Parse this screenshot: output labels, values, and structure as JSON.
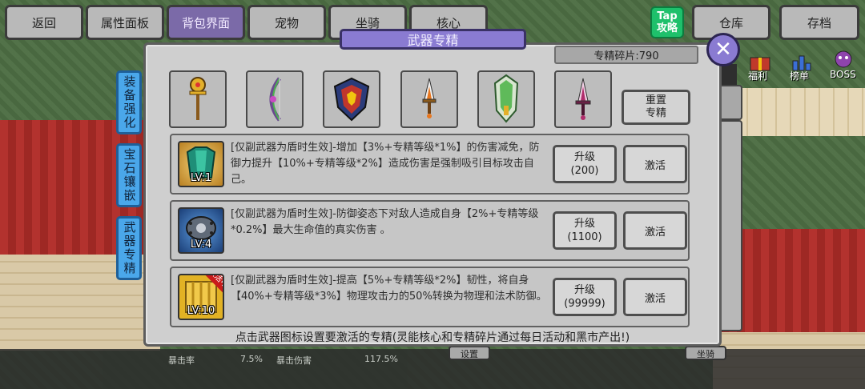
{
  "top_nav": {
    "items": [
      "返回",
      "属性面板",
      "背包界面",
      "宠物",
      "坐骑",
      "核心"
    ],
    "active_index": 2,
    "logo_text": "Tap\n攻略",
    "right_items": [
      "仓库",
      "存档"
    ]
  },
  "background": {
    "side_icon_labels": [
      "福利",
      "榜单",
      "BOSS"
    ],
    "bottom_cells": [
      "暴击率",
      "7.5%",
      "暴击伤害",
      "117.5%"
    ],
    "bottom_buttons": [
      "设置",
      "坐骑"
    ]
  },
  "modal": {
    "title": "武器专精",
    "shards_label": "专精碎片:790",
    "left_tabs": [
      {
        "label": "装备强化"
      },
      {
        "label": "宝石镶嵌"
      },
      {
        "label": "武器专精"
      }
    ],
    "weapons": [
      {
        "icon": "golden-staff-icon",
        "color": "#d9a521"
      },
      {
        "icon": "dragon-bow-icon",
        "color": "#7a5aa0"
      },
      {
        "icon": "crested-shield-icon",
        "color": "#c1362c"
      },
      {
        "icon": "flame-dagger-icon",
        "color": "#e8771f"
      },
      {
        "icon": "emerald-shield-icon",
        "color": "#5fba5a"
      },
      {
        "icon": "crimson-dagger-icon",
        "color": "#b02c6b"
      }
    ],
    "reset_label_1": "重置",
    "reset_label_2": "专精",
    "rows": [
      {
        "icon": "jade-armor-icon",
        "level": "LV:1",
        "text": "[仅副武器为盾时生效]-增加【3%+专精等级*1%】的伤害减免，防御力提升【10%+专精等级*2%】造成伤害是强制吸引目标攻击自己。",
        "upgrade_label": "升级",
        "upgrade_cost": "(200)",
        "activate_label": "激活"
      },
      {
        "icon": "spiked-shield-icon",
        "level": "LV:4",
        "text": "[仅副武器为盾时生效]-防御姿态下对敌人造成自身【2%+专精等级*0.2%】最大生命值的真实伤害 。",
        "upgrade_label": "升级",
        "upgrade_cost": "(1100)",
        "activate_label": "激活"
      },
      {
        "icon": "golden-gate-icon",
        "level": "LV:10",
        "ribbon": "激活中",
        "text": "[仅副武器为盾时生效]-提高【5%+专精等级*2%】韧性，将自身【40%+专精等级*3%】物理攻击力的50%转换为物理和法术防御。",
        "upgrade_label": "升级",
        "upgrade_cost": "(99999)",
        "activate_label": "激活"
      }
    ],
    "footer_tip": "点击武器图标设置要激活的专精(灵能核心和专精碎片通过每日活动和黑市产出!)"
  }
}
